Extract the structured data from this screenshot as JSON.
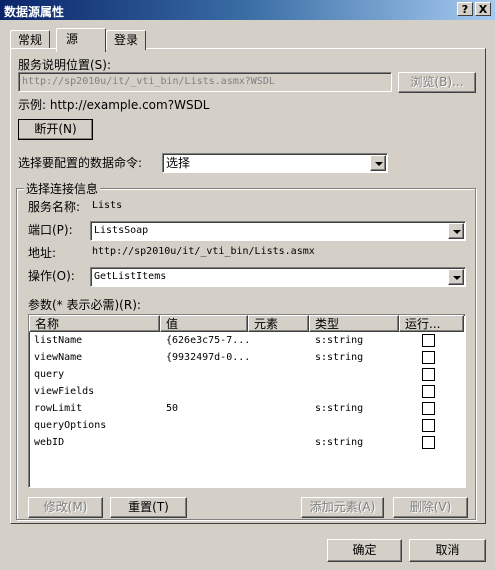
{
  "window": {
    "title": "数据源属性",
    "help_glyph": "?",
    "close_glyph": "X"
  },
  "tabs": [
    {
      "label": "常规"
    },
    {
      "label": "源"
    },
    {
      "label": "登录"
    }
  ],
  "service": {
    "label": "服务说明位置(S):",
    "value": "http://sp2010u/it/_vti_bin/Lists.asmx?WSDL",
    "browse": "浏览(B)...",
    "example": "示例: http://example.com?WSDL",
    "disconnect": "断开(N)"
  },
  "command": {
    "label": "选择要配置的数据命令:",
    "value": "选择"
  },
  "connection": {
    "group_label": "选择连接信息",
    "service_name_label": "服务名称:",
    "service_name_value": "Lists",
    "port_label": "端口(P):",
    "port_value": "ListsSoap",
    "address_label": "地址:",
    "address_value": "http://sp2010u/it/_vti_bin/Lists.asmx",
    "operation_label": "操作(O):",
    "operation_value": "GetListItems"
  },
  "params": {
    "label": "参数(* 表示必需)(R):",
    "columns": [
      "名称",
      "值",
      "元素",
      "类型",
      "运行..."
    ],
    "rows": [
      {
        "name": "listName",
        "value": "{626e3c75-7...",
        "element": "",
        "type": "s:string"
      },
      {
        "name": "viewName",
        "value": "{9932497d-0...",
        "element": "",
        "type": "s:string"
      },
      {
        "name": "query",
        "value": "",
        "element": "",
        "type": ""
      },
      {
        "name": "viewFields",
        "value": "",
        "element": "",
        "type": ""
      },
      {
        "name": "rowLimit",
        "value": "50",
        "element": "",
        "type": "s:string"
      },
      {
        "name": "queryOptions",
        "value": "",
        "element": "",
        "type": ""
      },
      {
        "name": "webID",
        "value": "",
        "element": "",
        "type": "s:string"
      }
    ],
    "buttons": {
      "modify": "修改(M)",
      "reset": "重置(T)",
      "add_element": "添加元素(A)",
      "delete": "删除(V)"
    }
  },
  "footer": {
    "ok": "确定",
    "cancel": "取消"
  }
}
